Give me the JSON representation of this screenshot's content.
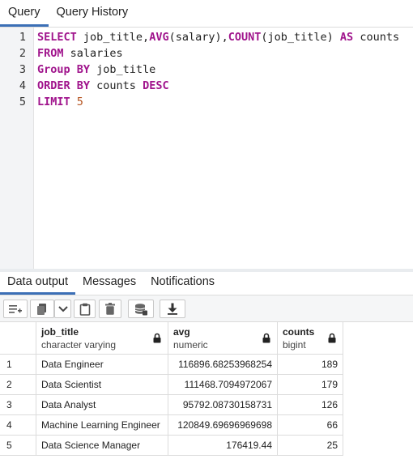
{
  "query_tabs": [
    "Query",
    "Query History"
  ],
  "editor": {
    "line_numbers": [
      "1",
      "2",
      "3",
      "4",
      "5"
    ],
    "lines": [
      [
        {
          "t": "SELECT",
          "c": "kw"
        },
        {
          "t": " job_title,",
          "c": ""
        },
        {
          "t": "AVG",
          "c": "fn"
        },
        {
          "t": "(salary),",
          "c": ""
        },
        {
          "t": "COUNT",
          "c": "fn"
        },
        {
          "t": "(job_title) ",
          "c": ""
        },
        {
          "t": "AS",
          "c": "kw"
        },
        {
          "t": " counts",
          "c": ""
        }
      ],
      [
        {
          "t": "FROM",
          "c": "kw"
        },
        {
          "t": " salaries",
          "c": ""
        }
      ],
      [
        {
          "t": "Group BY",
          "c": "kw"
        },
        {
          "t": " job_title",
          "c": ""
        }
      ],
      [
        {
          "t": "ORDER BY",
          "c": "kw"
        },
        {
          "t": " counts ",
          "c": ""
        },
        {
          "t": "DESC",
          "c": "kw"
        }
      ],
      [
        {
          "t": "LIMIT",
          "c": "kw"
        },
        {
          "t": " ",
          "c": ""
        },
        {
          "t": "5",
          "c": "num"
        }
      ]
    ]
  },
  "output_tabs": [
    "Data output",
    "Messages",
    "Notifications"
  ],
  "toolbar_icons": [
    "add-row-icon",
    "copy-icon",
    "chevron-down-icon",
    "paste-icon",
    "delete-icon",
    "save-data-icon",
    "download-icon"
  ],
  "grid": {
    "columns": [
      {
        "name": "job_title",
        "type": "character varying",
        "align": "left"
      },
      {
        "name": "avg",
        "type": "numeric",
        "align": "right"
      },
      {
        "name": "counts",
        "type": "bigint",
        "align": "right"
      }
    ],
    "rows": [
      {
        "n": "1",
        "cells": [
          "Data Engineer",
          "116896.68253968254",
          "189"
        ]
      },
      {
        "n": "2",
        "cells": [
          "Data Scientist",
          "111468.7094972067",
          "179"
        ]
      },
      {
        "n": "3",
        "cells": [
          "Data Analyst",
          "95792.08730158731",
          "126"
        ]
      },
      {
        "n": "4",
        "cells": [
          "Machine Learning Engineer",
          "120849.69696969698",
          "66"
        ]
      },
      {
        "n": "5",
        "cells": [
          "Data Science Manager",
          "176419.44",
          "25"
        ]
      }
    ]
  },
  "colors": {
    "accent": "#3b6fb6",
    "keyword": "#a0148c",
    "number": "#b5531f"
  }
}
